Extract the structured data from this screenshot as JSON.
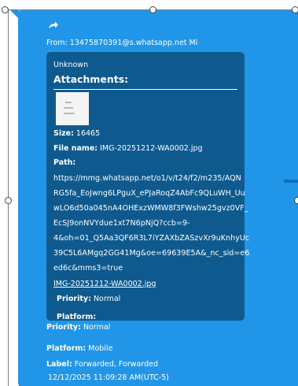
{
  "message": {
    "forward_icon": "forward-arrow-icon",
    "from_label": "From:",
    "from_value": "13475870391@s.whatsapp.net Mi",
    "attachment": {
      "sender": "Unknown",
      "heading": "Attachments:",
      "thumbnail_icon": "image-thumbnail",
      "size_label": "Size:",
      "size_value": "16465",
      "filename_label": "File name:",
      "filename_value": "IMG-20251212-WA0002.jpg",
      "path_label": "Path:",
      "path_lines": [
        "https://mmg.whatsapp.net/o1/v/t24/f2/m235/AQN",
        "RG5fa_EoJwng6LPguX_ePJaRoqZ4AbFc9QLuWH_Uu",
        "wLO6d50a045nA4OHExzWMW8f3FWshw25gvz0VF_",
        "EcSJ9onNVYdue1xt7N6pNjQ?ccb=9-",
        "4&oh=01_Q5Aa3QF6R3L7iYZAXbZASzvXr9uKnhyUc",
        "39C5L6AMgq2GG41Mg&oe=69639E5A&_nc_sid=e6",
        "ed6c&mms3=true"
      ],
      "link_text": "IMG-20251212-WA0002.jpg",
      "priority_label": "Priority:",
      "priority_value": "Normal",
      "platform_label": "Platform:",
      "platform_value": ""
    },
    "priority_label": "Priority:",
    "priority_value": "Normal",
    "platform_label": "Platform:",
    "platform_value": "Mobile",
    "label_label": "Label:",
    "label_value": "Forwarded, Forwarded",
    "timestamp": "12/12/2025 11:09:28 AM(UTC-5)"
  },
  "colors": {
    "bubble": "#2196e8",
    "card": "#0e5a8f",
    "text": "#ffffff"
  }
}
